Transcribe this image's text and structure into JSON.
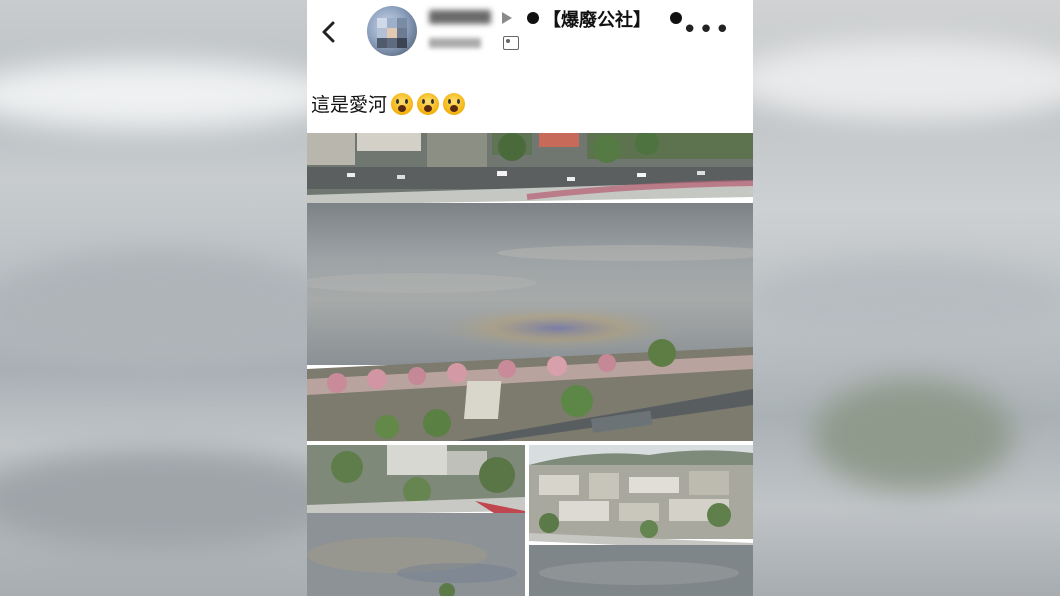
{
  "header": {
    "back_icon": "chevron-left-icon",
    "group_name": "【爆廢公社】",
    "more_icon": "more-horizontal-icon",
    "audience_icon": "friends-icon"
  },
  "post": {
    "caption_text": "這是愛河",
    "emojis": [
      "scream-emoji",
      "scream-emoji",
      "scream-emoji"
    ]
  },
  "colors": {
    "background_blur": "#c4c8cb",
    "panel": "#ffffff",
    "text": "#111111",
    "water": "#8e9498"
  }
}
